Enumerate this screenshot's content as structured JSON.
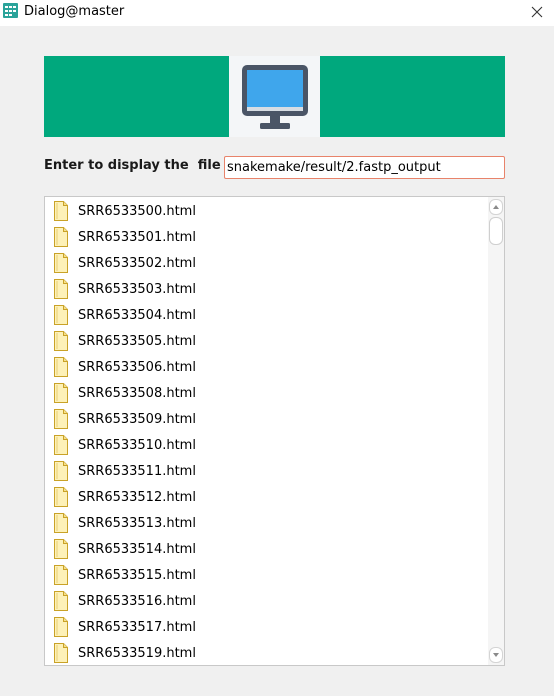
{
  "window": {
    "title": "Dialog@master",
    "close_glyph": "✕"
  },
  "icons": {
    "app": "app-icon",
    "banner": "monitor-icon",
    "file": "file-icon"
  },
  "colors": {
    "banner": "#00a87d",
    "input_border": "#e8836a"
  },
  "prompt": {
    "label": "Enter to display the  file"
  },
  "path_input": {
    "value": "snakemake/result/2.fastp_output"
  },
  "files": [
    "SRR6533500.html",
    "SRR6533501.html",
    "SRR6533502.html",
    "SRR6533503.html",
    "SRR6533504.html",
    "SRR6533505.html",
    "SRR6533506.html",
    "SRR6533508.html",
    "SRR6533509.html",
    "SRR6533510.html",
    "SRR6533511.html",
    "SRR6533512.html",
    "SRR6533513.html",
    "SRR6533514.html",
    "SRR6533515.html",
    "SRR6533516.html",
    "SRR6533517.html",
    "SRR6533519.html"
  ]
}
